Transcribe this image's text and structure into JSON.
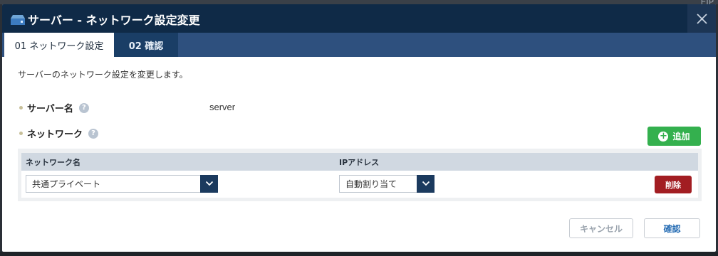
{
  "background": {
    "corner_text": "EIP"
  },
  "dialog": {
    "title": "サーバー - ネットワーク設定変更",
    "close_glyph": "×",
    "tabs": [
      {
        "label": "01 ネットワーク設定",
        "active": true
      },
      {
        "label": "02 確認",
        "active": false
      }
    ],
    "description": "サーバーのネットワーク設定を変更します。",
    "fields": {
      "server_name_label": "サーバー名",
      "server_name_value": "server",
      "network_label": "ネットワーク",
      "help_glyph": "?"
    },
    "add_button": {
      "label": "追加",
      "icon": "plus-circle-icon"
    },
    "table": {
      "headers": {
        "name": "ネットワーク名",
        "ip": "IPアドレス"
      },
      "rows": [
        {
          "network": "共通プライベート",
          "ip": "自動割り当て",
          "delete_label": "削除"
        }
      ]
    },
    "footer": {
      "cancel": "キャンセル",
      "confirm": "確認"
    }
  },
  "colors": {
    "title_bar": "#0f2a47",
    "tab_bar": "#2e507e",
    "add_green": "#34b04e",
    "delete_red": "#a21d22",
    "select_arrow_bg": "#1b3a5e"
  }
}
